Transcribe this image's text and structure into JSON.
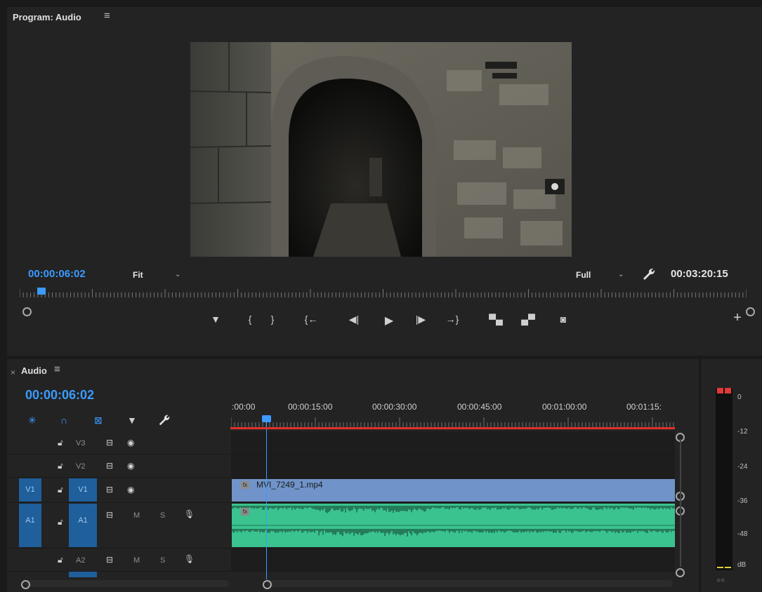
{
  "program": {
    "title": "Program: Audio",
    "menu_icon": "hamburger-icon",
    "current_timecode": "00:00:06:02",
    "zoom_select": "Fit",
    "quality_select": "Full",
    "duration_timecode": "00:03:20:15",
    "playhead_position": 0.03
  },
  "transport": {
    "buttons": [
      "add-marker-icon",
      "mark-in-icon",
      "mark-out-icon",
      "go-to-in-icon",
      "step-back-icon",
      "play-icon",
      "step-forward-icon",
      "go-to-out-icon",
      "lift-icon",
      "extract-icon",
      "export-frame-icon",
      "add-button-icon"
    ]
  },
  "timeline": {
    "title": "Audio",
    "timecode": "00:00:06:02",
    "ruler_labels": [
      ":00:00",
      "00:00:15:00",
      "00:00:30:00",
      "00:00:45:00",
      "00:01:00:00",
      "00:01:15:"
    ],
    "tracks": [
      {
        "source": "",
        "name": "V3",
        "toggle": "toggle-sync-lock-icon"
      },
      {
        "source": "",
        "name": "V2"
      },
      {
        "source": "V1",
        "name": "V1"
      },
      {
        "source": "A1",
        "name": "A1",
        "m": "M",
        "s": "S"
      },
      {
        "source": "",
        "name": "A2",
        "m": "M",
        "s": "S"
      }
    ],
    "clip": {
      "name": "MVI_7249_1.mp4",
      "fx": "fx"
    },
    "colors": {
      "video_clip": "#7094c9",
      "audio_clip": "#3ac38f",
      "playhead": "#3b9bff",
      "work_area": "#e0302a"
    }
  },
  "meter": {
    "labels": [
      "0",
      "-12",
      "-24",
      "-36",
      "-48",
      "dB"
    ],
    "solo_label": "○○"
  }
}
